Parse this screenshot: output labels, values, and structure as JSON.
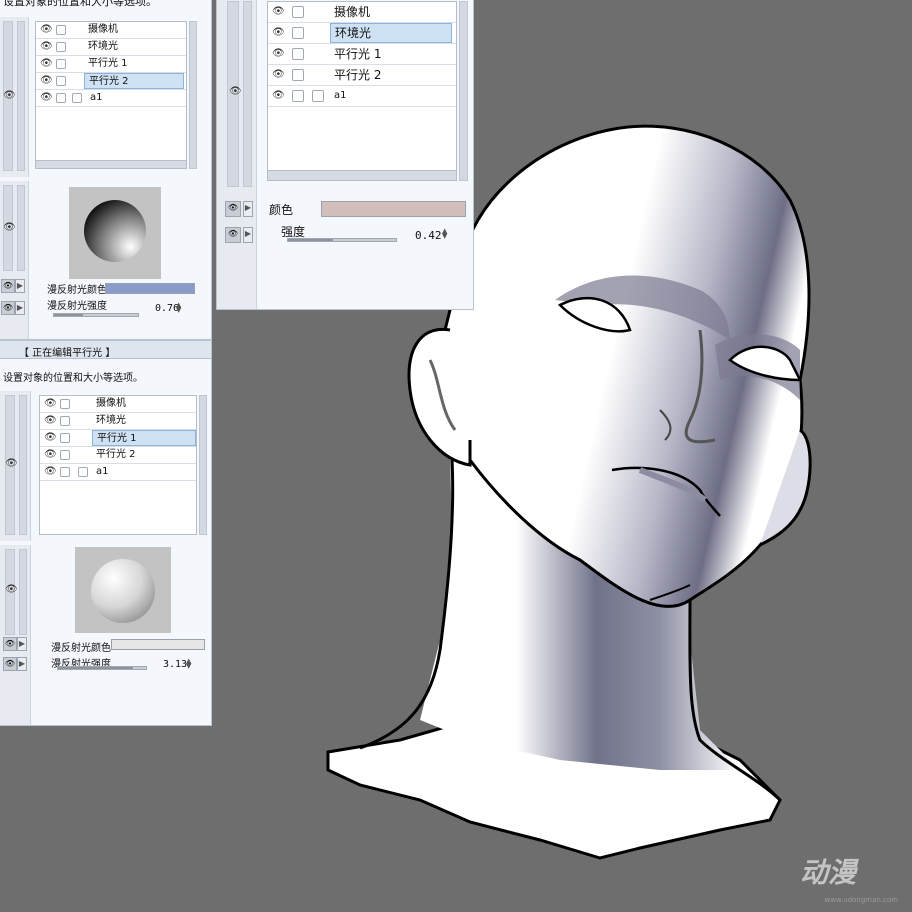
{
  "panel_a": {
    "header": "设置对象的位置和大小等选项。",
    "layers": [
      {
        "name": "摄像机"
      },
      {
        "name": "环境光"
      },
      {
        "name": "平行光 1"
      },
      {
        "name": "平行光 2",
        "selected": true
      },
      {
        "name": "a1"
      }
    ],
    "diffuse_color_label": "漫反射光颜色",
    "diffuse_color_hex": "#8a9ccc",
    "diffuse_strength_label": "漫反射光强度",
    "diffuse_strength_value": "0.76",
    "diffuse_strength_fraction": 0.35
  },
  "panel_b": {
    "layers": [
      {
        "name": "摄像机"
      },
      {
        "name": "环境光",
        "selected": true
      },
      {
        "name": "平行光 1"
      },
      {
        "name": "平行光 2"
      },
      {
        "name": "a1"
      }
    ],
    "color_label": "颜色",
    "color_hex": "#d2bfbb",
    "strength_label": "强度",
    "strength_value": "0.42",
    "strength_fraction": 0.42
  },
  "panel_c": {
    "title": "【 正在编辑平行光 】",
    "header": "设置对象的位置和大小等选项。",
    "layers": [
      {
        "name": "摄像机"
      },
      {
        "name": "环境光"
      },
      {
        "name": "平行光 1",
        "selected": true
      },
      {
        "name": "平行光 2"
      },
      {
        "name": "a1"
      }
    ],
    "diffuse_color_label": "漫反射光颜色",
    "diffuse_color_hex": "#e6e6e6",
    "diffuse_strength_label": "漫反射光强度",
    "diffuse_strength_value": "3.13",
    "diffuse_strength_fraction": 0.85
  },
  "icons": {
    "visibility": "eye-icon",
    "lock": "checkbox-icon",
    "spin": "spinner-arrows-icon",
    "expand": "expand-arrow-icon"
  },
  "colors": {
    "canvas": "#6e6e6e",
    "panel": "#f4f7fc",
    "selection": "#cfe2f4",
    "head_shadow": "#6d6e86"
  },
  "watermark": {
    "logo": "动漫",
    "url": "www.udongman.com"
  }
}
